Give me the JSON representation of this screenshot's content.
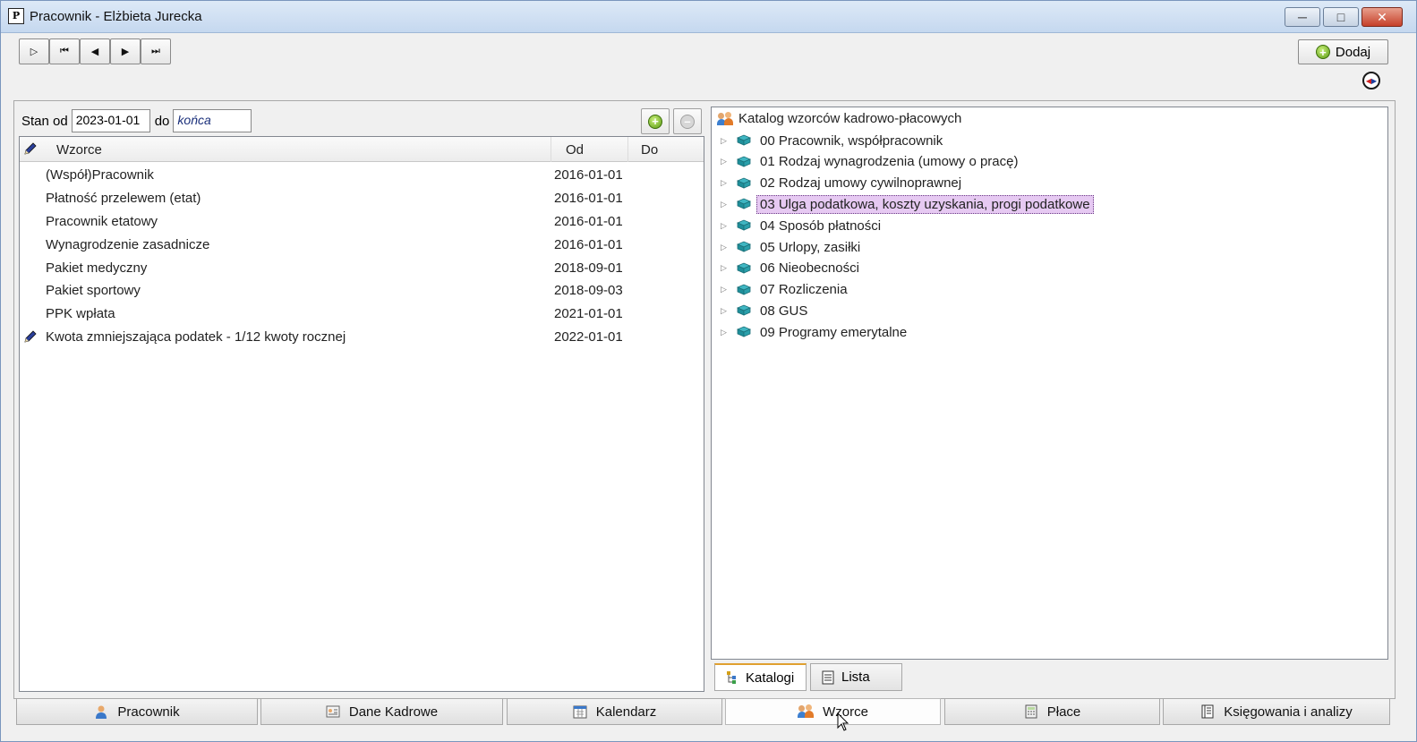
{
  "window": {
    "title": "Pracownik - Elżbieta Jurecka",
    "app_icon_letter": "P"
  },
  "toolbar": {
    "nav_buttons": [
      "▷",
      "⏮",
      "◀",
      "▶",
      "⏭"
    ],
    "add_label": "Dodaj"
  },
  "filter": {
    "from_label": "Stan od",
    "from_value": "2023-01-01",
    "to_label": "do",
    "to_value": "końca"
  },
  "grid": {
    "headers": {
      "name": "Wzorce",
      "from": "Od",
      "to": "Do"
    },
    "rows": [
      {
        "name": "(Współ)Pracownik",
        "from": "2016-01-01",
        "to": "",
        "edited": false
      },
      {
        "name": "Płatność przelewem (etat)",
        "from": "2016-01-01",
        "to": "",
        "edited": false
      },
      {
        "name": "Pracownik etatowy",
        "from": "2016-01-01",
        "to": "",
        "edited": false
      },
      {
        "name": "Wynagrodzenie zasadnicze",
        "from": "2016-01-01",
        "to": "",
        "edited": false
      },
      {
        "name": "Pakiet medyczny",
        "from": "2018-09-01",
        "to": "",
        "edited": false
      },
      {
        "name": "Pakiet sportowy",
        "from": "2018-09-03",
        "to": "",
        "edited": false
      },
      {
        "name": "PPK wpłata",
        "from": "2021-01-01",
        "to": "",
        "edited": false
      },
      {
        "name": "Kwota zmniejszająca podatek - 1/12 kwoty rocznej",
        "from": "2022-01-01",
        "to": "",
        "edited": true
      }
    ]
  },
  "tree": {
    "root": "Katalog wzorców kadrowo-płacowych",
    "items": [
      {
        "label": "00 Pracownik, współpracownik",
        "selected": false
      },
      {
        "label": "01 Rodzaj wynagrodzenia (umowy o pracę)",
        "selected": false
      },
      {
        "label": "02 Rodzaj umowy cywilnoprawnej",
        "selected": false
      },
      {
        "label": "03 Ulga podatkowa, koszty uzyskania, progi podatkowe",
        "selected": true
      },
      {
        "label": "04 Sposób płatności",
        "selected": false
      },
      {
        "label": "05 Urlopy, zasiłki",
        "selected": false
      },
      {
        "label": "06 Nieobecności",
        "selected": false
      },
      {
        "label": "07 Rozliczenia",
        "selected": false
      },
      {
        "label": "08 GUS",
        "selected": false
      },
      {
        "label": "09 Programy emerytalne",
        "selected": false
      }
    ]
  },
  "sub_tabs": [
    {
      "label": "Katalogi",
      "active": true
    },
    {
      "label": "Lista",
      "active": false
    }
  ],
  "bottom_tabs": [
    {
      "label": "Pracownik",
      "icon": "person-icon",
      "active": false
    },
    {
      "label": "Dane Kadrowe",
      "icon": "card-icon",
      "active": false
    },
    {
      "label": "Kalendarz",
      "icon": "calendar-icon",
      "active": false
    },
    {
      "label": "Wzorce",
      "icon": "people-icon",
      "active": true
    },
    {
      "label": "Płace",
      "icon": "calculator-icon",
      "active": false
    },
    {
      "label": "Księgowania i analizy",
      "icon": "ledger-icon",
      "active": false
    }
  ],
  "colors": {
    "selection": "#e6c9f2",
    "plus_green": "#5a9a13",
    "book_teal": "#2a9aa6"
  }
}
